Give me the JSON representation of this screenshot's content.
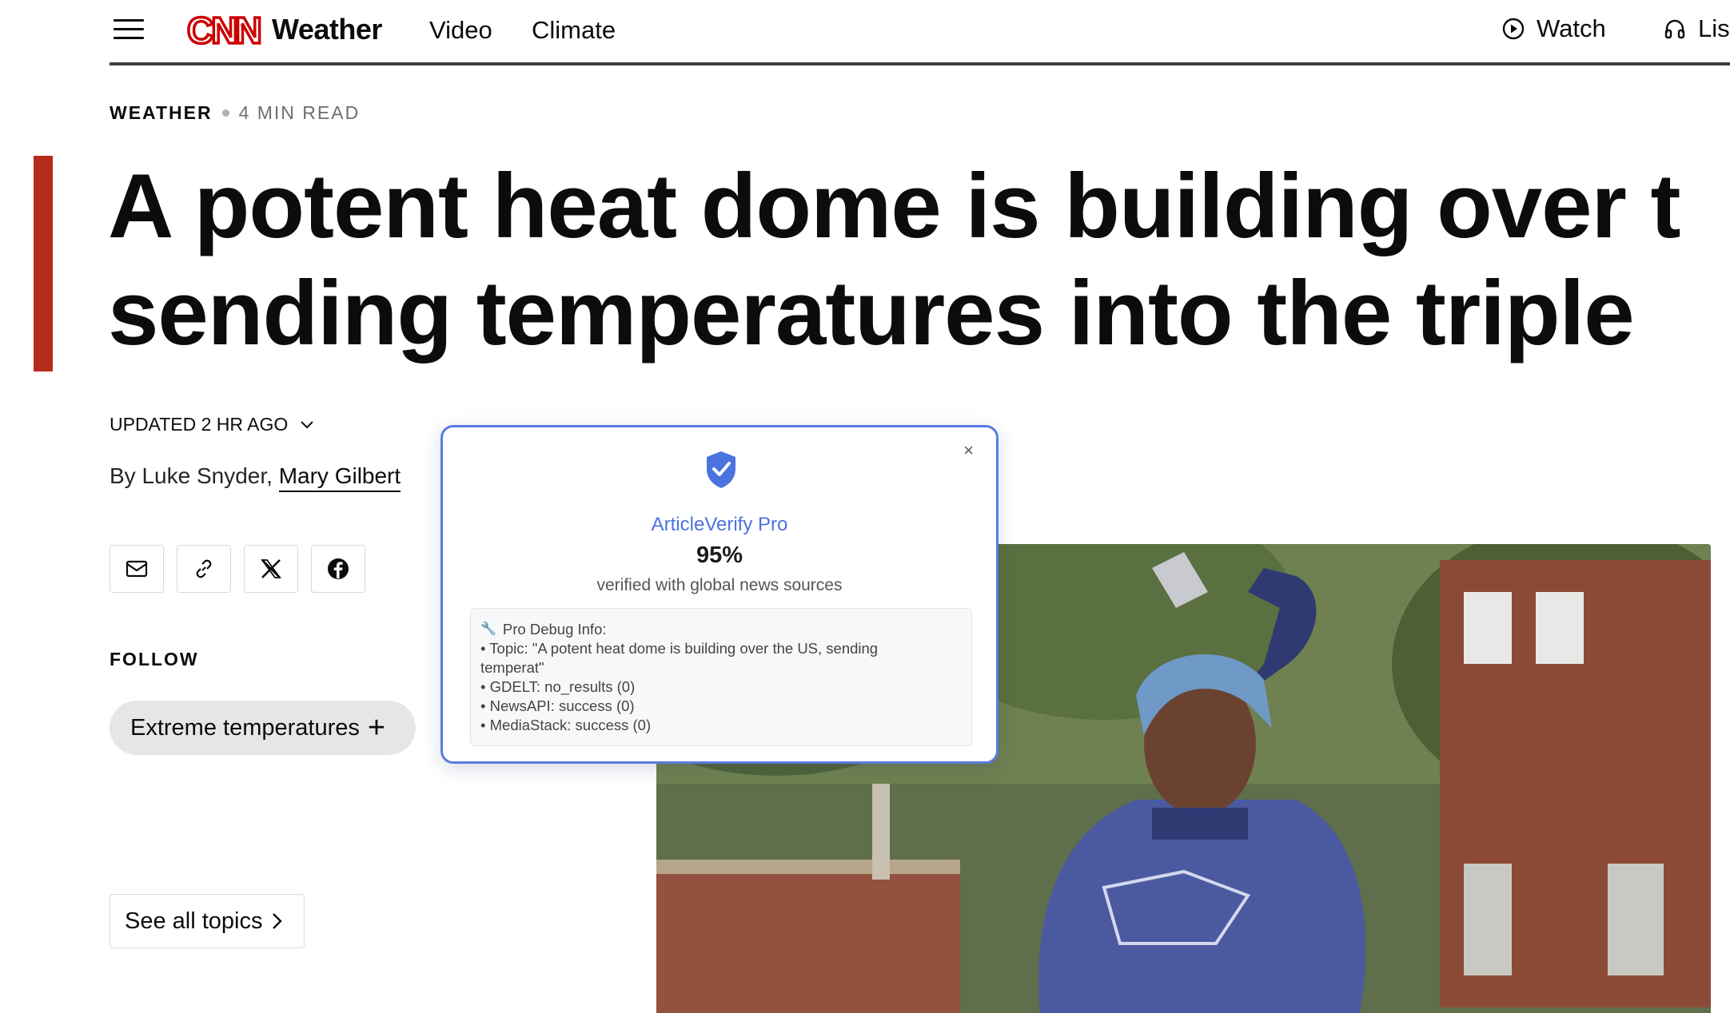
{
  "header": {
    "logo_text": "CNN",
    "section_title": "Weather",
    "nav_links": [
      "Video",
      "Climate"
    ],
    "watch_label": "Watch",
    "listen_label": "Lis",
    "brand_color": "#cc0000"
  },
  "article": {
    "kicker_section": "WEATHER",
    "kicker_readtime": "4 MIN READ",
    "headline_line1": "A potent heat dome is building over t",
    "headline_line2": "sending temperatures into the triple",
    "updated_label": "UPDATED 2 HR AGO",
    "byline_prefix": "By Luke Snyder, ",
    "byline_link": "Mary Gilbert",
    "share_buttons": [
      "mail-icon",
      "link-icon",
      "x-icon",
      "facebook-icon"
    ],
    "follow_label": "FOLLOW",
    "topic_chip": "Extreme temperatures",
    "see_all_label": "See all topics",
    "accent_color": "#b72b1c"
  },
  "popup": {
    "title": "ArticleVerify Pro",
    "score": "95%",
    "subtitle": "verified with global news sources",
    "close_label": "×",
    "debug_header": "Pro Debug Info:",
    "debug_lines": [
      "• Topic: \"A potent heat dome is building over the US, sending",
      "temperat\"",
      "• GDELT: no_results (0)",
      "• NewsAPI: success (0)",
      "• MediaStack: success (0)"
    ],
    "accent_color": "#4a73e0"
  }
}
